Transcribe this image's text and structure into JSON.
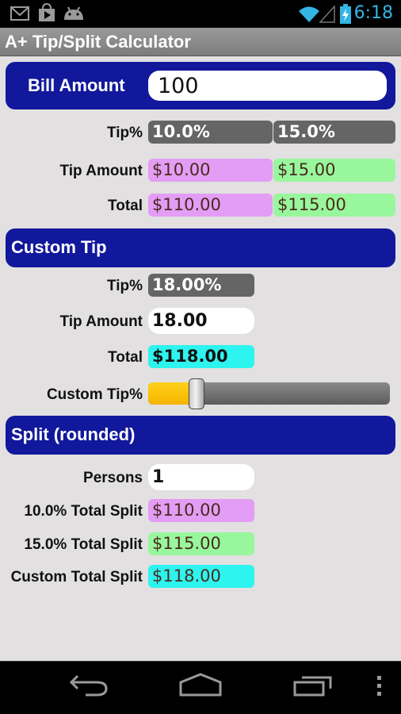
{
  "status_bar": {
    "left_icons": [
      "gmail-icon",
      "play-store-icon",
      "android-debug-icon"
    ],
    "right_icons": [
      "wifi-icon",
      "cell-signal-icon",
      "battery-charging-icon"
    ],
    "time": "6:18",
    "time_color": "#33b5e5"
  },
  "app": {
    "title": "A+ Tip/Split Calculator"
  },
  "bill": {
    "label": "Bill Amount",
    "value": "100"
  },
  "preset": {
    "tip_pct_label": "Tip%",
    "tip_amount_label": "Tip Amount",
    "total_label": "Total",
    "columns": [
      {
        "tip_pct": "10.0%",
        "tip_amount": "$10.00",
        "total": "$110.00"
      },
      {
        "tip_pct": "15.0%",
        "tip_amount": "$15.00",
        "total": "$115.00"
      }
    ]
  },
  "custom": {
    "header": "Custom Tip",
    "tip_pct_label": "Tip%",
    "tip_pct": "18.00%",
    "tip_amount_label": "Tip Amount",
    "tip_amount": "18.00",
    "total_label": "Total",
    "total": "$118.00",
    "slider_label": "Custom Tip%",
    "slider_fraction": 0.2
  },
  "split": {
    "header": "Split (rounded)",
    "persons_label": "Persons",
    "persons": "1",
    "rows": [
      {
        "label": "10.0% Total Split",
        "value": "$110.00"
      },
      {
        "label": "15.0% Total Split",
        "value": "$115.00"
      },
      {
        "label": "Custom Total Split",
        "value": "$118.00"
      }
    ]
  },
  "colors": {
    "header_blue": "#11189c",
    "tip_gray": "#646564",
    "ten_pct_pink": "#e39df4",
    "fifteen_pct_green": "#98f79c",
    "custom_cyan": "#2ef4ef",
    "slider_orange": "#ffc80a"
  },
  "nav": {
    "buttons": [
      "back-icon",
      "home-icon",
      "recent-apps-icon",
      "overflow-menu-icon"
    ]
  }
}
